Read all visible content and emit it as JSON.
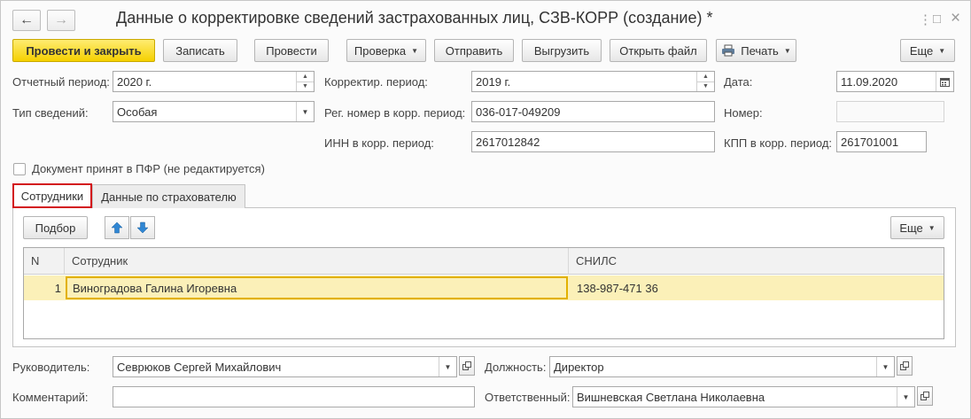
{
  "window": {
    "title": "Данные о корректировке сведений застрахованных лиц, СЗВ-КОРР (создание) *",
    "back_icon": "←",
    "forward_icon": "→",
    "more_icon": "⋮",
    "maximize_icon": "□",
    "close_icon": "×"
  },
  "toolbar": {
    "post_close": "Провести и закрыть",
    "save": "Записать",
    "post": "Провести",
    "check": "Проверка",
    "send": "Отправить",
    "export": "Выгрузить",
    "open_file": "Открыть файл",
    "print": "Печать",
    "more": "Еще"
  },
  "form": {
    "period_label": "Отчетный период:",
    "period_value": "2020 г.",
    "info_type_label": "Тип сведений:",
    "info_type_value": "Особая",
    "corr_period_label": "Корректир. период:",
    "corr_period_value": "2019 г.",
    "reg_num_label": "Рег. номер в корр. период:",
    "reg_num_value": "036-017-049209",
    "inn_label": "ИНН в корр. период:",
    "inn_value": "2617012842",
    "date_label": "Дата:",
    "date_value": "11.09.2020",
    "number_label": "Номер:",
    "number_value": "",
    "kpp_label": "КПП в корр. период:",
    "kpp_value": "261701001",
    "accepted_label": "Документ принят в ПФР (не редактируется)",
    "accepted_checked": false
  },
  "tabs": {
    "employees": "Сотрудники",
    "insurer": "Данные по страхователю"
  },
  "table_toolbar": {
    "select": "Подбор",
    "more": "Еще"
  },
  "table": {
    "columns": [
      "N",
      "Сотрудник",
      "СНИЛС"
    ],
    "rows": [
      {
        "n": "1",
        "employee": "Виноградова Галина Игоревна",
        "snils": "138-987-471 36"
      }
    ]
  },
  "footer": {
    "head_label": "Руководитель:",
    "head_value": "Севрюков Сергей Михайлович",
    "position_label": "Должность:",
    "position_value": "Директор",
    "comment_label": "Комментарий:",
    "comment_value": "",
    "responsible_label": "Ответственный:",
    "responsible_value": "Вишневская Светлана Николаевна"
  },
  "colors": {
    "primary_button": "#f5d000",
    "active_tab_border": "#d3131b",
    "selected_row": "#fbf0b8",
    "arrow_icon": "#2f86d3"
  }
}
